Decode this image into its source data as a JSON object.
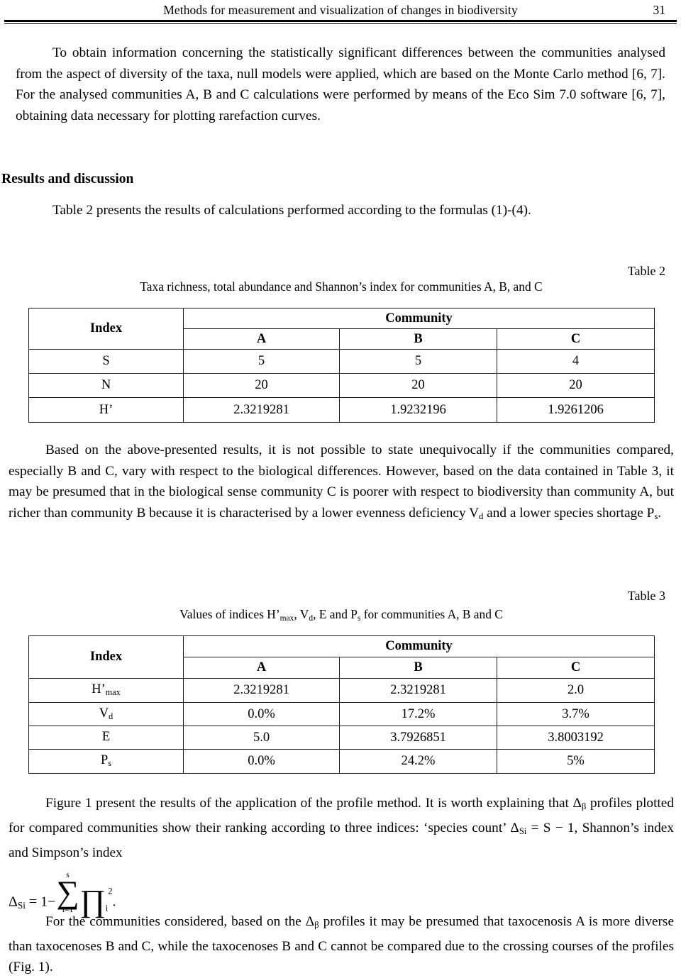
{
  "header": {
    "title": "Methods for measurement and visualization of changes in biodiversity",
    "page_number": "31"
  },
  "body": {
    "para1": "To obtain information concerning the statistically significant differences between the communities analysed from the aspect of diversity of the taxa, null models were applied, which are based on the Monte Carlo method [6, 7]. For the analysed communities A, B and C calculations were performed by means of the Eco Sim 7.0 software [6, 7], obtaining data necessary for plotting rarefaction curves.",
    "section_heading": "Results and discussion",
    "para2": "Table 2 presents the results of calculations performed according to the formulas (1)-(4).",
    "para3": "Based on the above-presented results, it is not possible to state unequivocally if the communities compared, especially B and C, vary with respect to the biological differences. However, based on the data contained in Table 3, it may be presumed that in the biological sense community C is poorer with respect to biodiversity than community A, but richer than community B because it is characterised by a lower evenness deficiency V",
    "para3_sub1": "d",
    "para3_cont": " and a lower species shortage P",
    "para3_sub2": "s",
    "para3_end": ".",
    "para4_a": "Figure 1 present the results of the application of the profile method. It is worth explaining that Δ",
    "para4_sub1": "β",
    "para4_b": " profiles plotted for compared communities show their ranking according to three indices: ‘species count’ Δ",
    "para4_sub2": "Si",
    "para4_c": " = S − 1, Shannon’s index and Simpson’s index",
    "para5_a": "For the communities considered, based on the Δ",
    "para5_sub1": "β",
    "para5_b": " profiles it may be presumed that taxocenosis A is more diverse than taxocenoses B and C, while the taxocenoses B and C cannot be compared due to the crossing courses of the profiles (Fig. 1)."
  },
  "formula": {
    "lhs": "Δ",
    "lhs_sub": "Si",
    "eq": " = 1−",
    "sum_upper": "s",
    "sum_symbol": "∑",
    "sum_lower": "i=1",
    "prod_symbol": "∏",
    "prod_sub": "i",
    "prod_sup": "2",
    "period": "."
  },
  "table2": {
    "number_label": "Table 2",
    "caption": "Taxa richness, total abundance and Shannon’s index for communities A, B, and C",
    "header_index": "Index",
    "header_group": "Community",
    "columns": [
      "A",
      "B",
      "C"
    ],
    "rows": [
      {
        "index": "S",
        "values": [
          "5",
          "5",
          "4"
        ]
      },
      {
        "index": "N",
        "values": [
          "20",
          "20",
          "20"
        ]
      },
      {
        "index": "H’",
        "values": [
          "2.3219281",
          "1.9232196",
          "1.9261206"
        ]
      }
    ]
  },
  "table3": {
    "number_label": "Table 3",
    "caption_a": "Values of indices H’",
    "caption_sub1": "max",
    "caption_b": ", V",
    "caption_sub2": "d",
    "caption_c": ", E and P",
    "caption_sub3": "s",
    "caption_d": " for communities A, B and C",
    "header_index": "Index",
    "header_group": "Community",
    "columns": [
      "A",
      "B",
      "C"
    ],
    "rows": [
      {
        "index": "H’",
        "index_sub": "max",
        "values": [
          "2.3219281",
          "2.3219281",
          "2.0"
        ]
      },
      {
        "index": "V",
        "index_sub": "d",
        "values": [
          "0.0%",
          "17.2%",
          "3.7%"
        ]
      },
      {
        "index": "E",
        "index_sub": "",
        "values": [
          "5.0",
          "3.7926851",
          "3.8003192"
        ]
      },
      {
        "index": "P",
        "index_sub": "s",
        "values": [
          "0.0%",
          "24.2%",
          "5%"
        ]
      }
    ]
  }
}
